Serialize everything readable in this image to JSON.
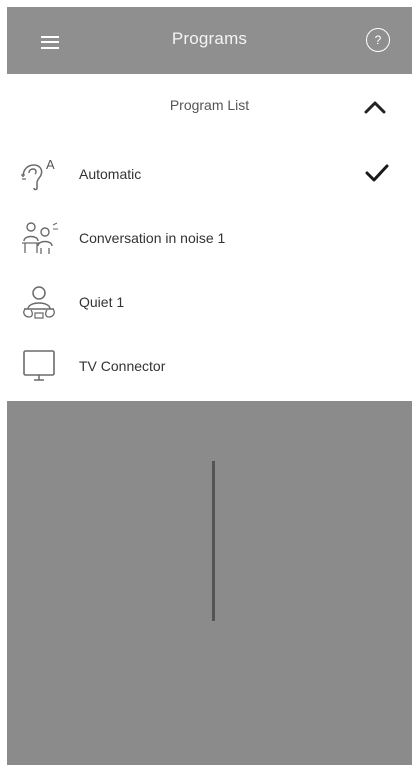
{
  "header": {
    "title": "Programs",
    "menu_icon": "hamburger-menu-icon",
    "help_icon": "help-icon",
    "help_glyph": "?"
  },
  "program_list": {
    "label": "Program List",
    "collapse_icon": "chevron-up-icon",
    "items": [
      {
        "label": "Automatic",
        "icon": "automatic-program-icon",
        "selected": true
      },
      {
        "label": "Conversation in noise 1",
        "icon": "conversation-in-noise-icon",
        "selected": false
      },
      {
        "label": "Quiet 1",
        "icon": "quiet-program-icon",
        "selected": false
      },
      {
        "label": "TV Connector",
        "icon": "tv-connector-icon",
        "selected": false
      }
    ]
  },
  "colors": {
    "header_bg": "#8f8f8f",
    "panel_bg": "#ffffff",
    "overlay_bg": "#8b8b8b",
    "text_dark": "#333333"
  }
}
